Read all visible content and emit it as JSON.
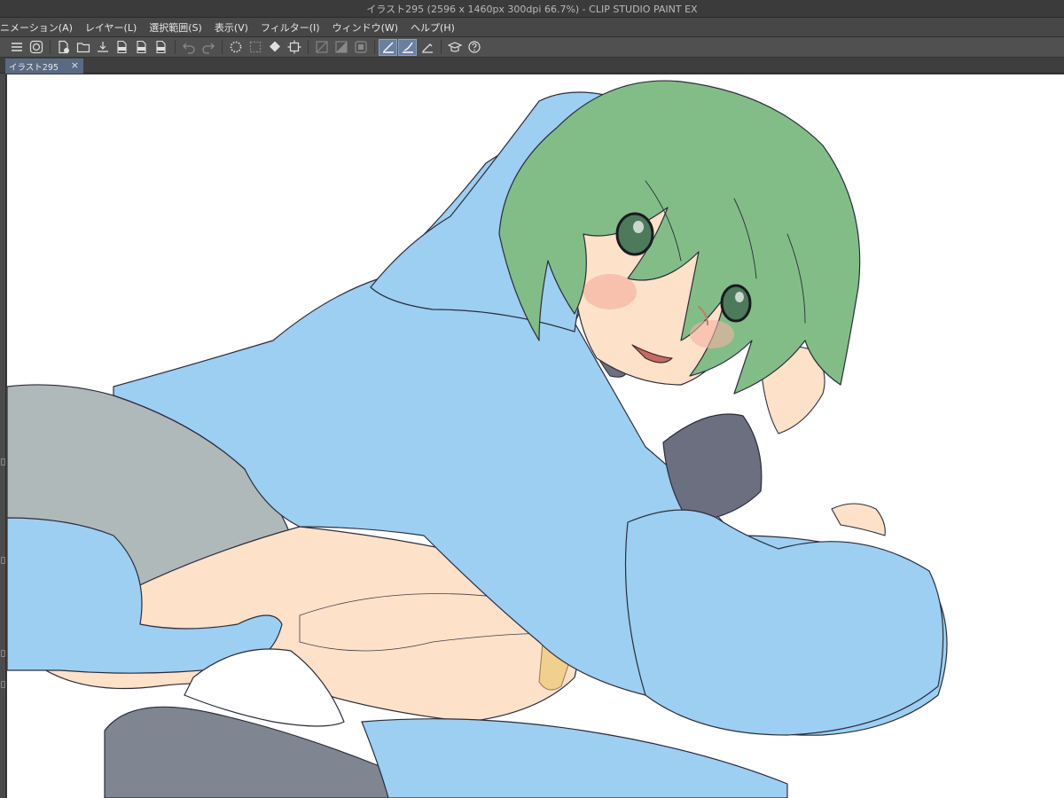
{
  "window": {
    "title": "イラスト295 (2596 x 1460px 300dpi 66.7%)  - CLIP STUDIO PAINT EX"
  },
  "menu": {
    "items": [
      {
        "label": "ニメーション(A)"
      },
      {
        "label": "レイヤー(L)"
      },
      {
        "label": "選択範囲(S)"
      },
      {
        "label": "表示(V)"
      },
      {
        "label": "フィルター(I)"
      },
      {
        "label": "ウィンドウ(W)"
      },
      {
        "label": "ヘルプ(H)"
      }
    ]
  },
  "toolbar": {
    "buttons": [
      {
        "icon": "menu-icon"
      },
      {
        "icon": "clip-studio-icon"
      },
      {
        "icon": "new-file-icon"
      },
      {
        "icon": "open-folder-icon"
      },
      {
        "icon": "save-icon"
      },
      {
        "icon": "export-jpg-icon"
      },
      {
        "icon": "export-png-icon"
      },
      {
        "icon": "export-psd-icon"
      },
      {
        "icon": "undo-icon"
      },
      {
        "icon": "redo-icon"
      },
      {
        "icon": "loading-icon"
      },
      {
        "icon": "clear-selection-icon"
      },
      {
        "icon": "fill-icon"
      },
      {
        "icon": "transform-icon"
      },
      {
        "icon": "snap-ruler-icon"
      },
      {
        "icon": "snap-special-ruler-icon"
      },
      {
        "icon": "snap-grid-icon"
      },
      {
        "icon": "stabilize-icon",
        "active": true
      },
      {
        "icon": "pen-stabilize-icon",
        "active": true
      },
      {
        "icon": "ruler-icon"
      },
      {
        "icon": "learn-icon"
      },
      {
        "icon": "help-icon"
      }
    ]
  },
  "document": {
    "tab_label": "イラスト295",
    "close_glyph": "×"
  },
  "colors": {
    "hair": "#82bd87",
    "hoodie": "#9ccff2",
    "skirt": "#b0b9b9",
    "skin": "#fde1c9",
    "sleeve": "#6b6f80",
    "shoe": "#7f8591",
    "outline": "#2c2c3c"
  }
}
